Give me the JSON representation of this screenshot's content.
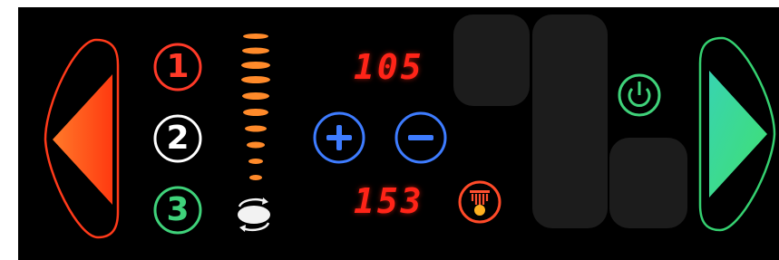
{
  "panel": {
    "colors": {
      "background": "#000000",
      "left_arrow": "#ff5a1e",
      "right_arrow": "#35e08a",
      "plus_minus": "#3e7cff",
      "display": "#ff2418",
      "level": "#ff8a2a"
    },
    "left_nav": {
      "icon": "left-arrow-icon"
    },
    "right_nav": {
      "icon": "right-arrow-icon"
    },
    "presets": [
      {
        "label": "1",
        "color": "#ff3a28"
      },
      {
        "label": "2",
        "color": "#ffffff"
      },
      {
        "label": "3",
        "color": "#3fd27a"
      }
    ],
    "level_meter": {
      "bars": 10,
      "icon": "flame-level-icon"
    },
    "display": {
      "top": "105",
      "bottom": "153"
    },
    "controls": {
      "plus_icon": "plus-icon",
      "minus_icon": "minus-icon",
      "fire_icon": "fire-icon",
      "power_icon": "power-icon",
      "cycle_icon": "cycle-icon"
    }
  }
}
